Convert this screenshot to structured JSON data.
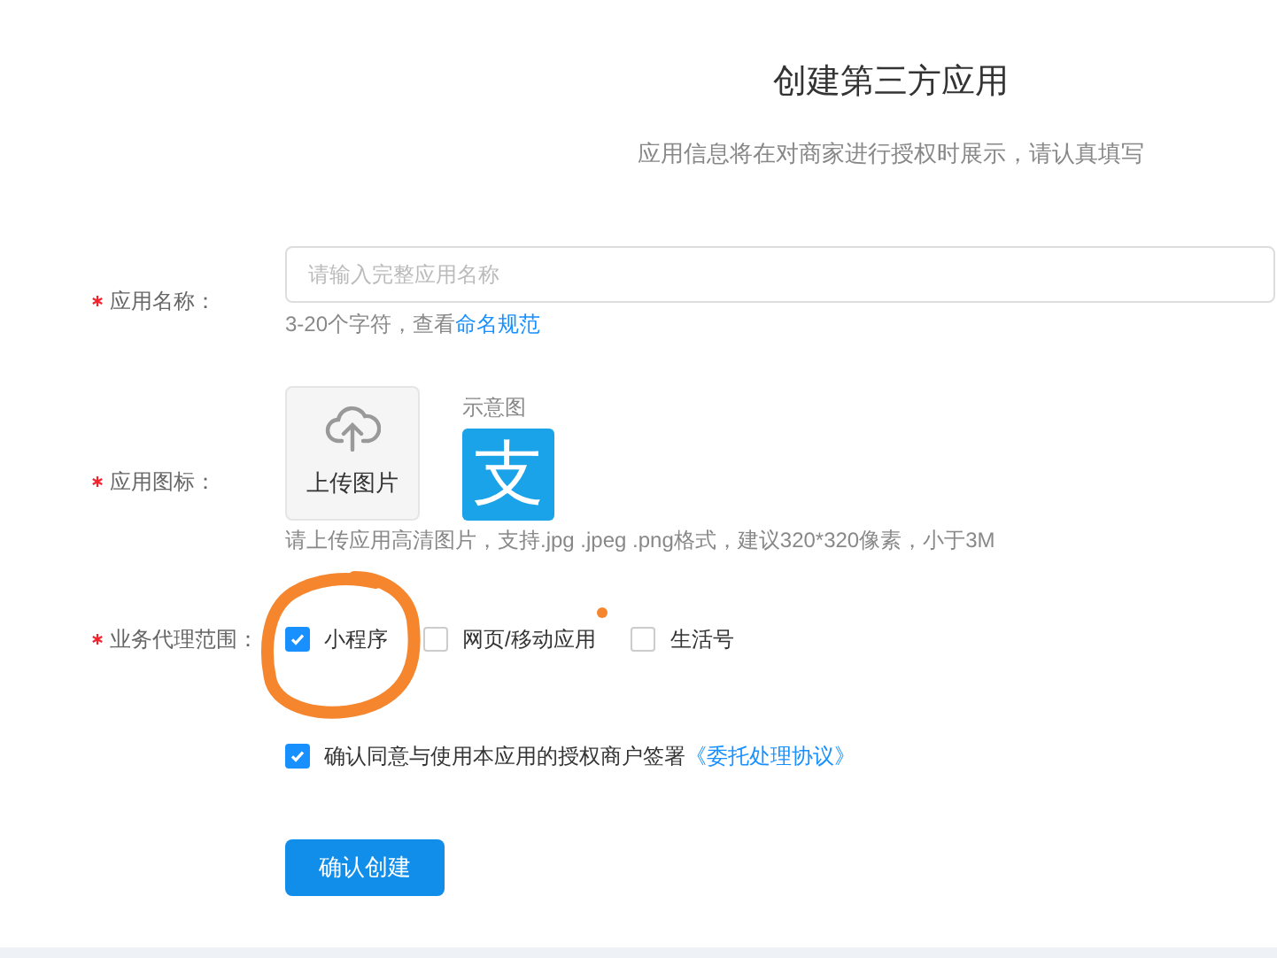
{
  "header": {
    "title": "创建第三方应用",
    "subtitle": "应用信息将在对商家进行授权时展示，请认真填写"
  },
  "name_field": {
    "label": "应用名称：",
    "required": true,
    "placeholder": "请输入完整应用名称",
    "hint": "3-20个字符，查看",
    "hint_link": "命名规范"
  },
  "icon_field": {
    "label": "应用图标：",
    "required": true,
    "upload_label": "上传图片",
    "example_label": "示意图",
    "example_logo": "支",
    "hint": "请上传应用高清图片，支持.jpg .jpeg .png格式，建议320*320像素，小于3M"
  },
  "scope_field": {
    "label": "业务代理范围：",
    "required": true,
    "options": [
      {
        "label": "小程序",
        "checked": true,
        "new": false
      },
      {
        "label": "网页/移动应用",
        "checked": false,
        "new": true
      },
      {
        "label": "生活号",
        "checked": false,
        "new": false
      }
    ]
  },
  "agreement": {
    "checked": true,
    "text": "确认同意与使用本应用的授权商户签署",
    "link": "《委托处理协议》"
  },
  "submit_button": "确认创建"
}
